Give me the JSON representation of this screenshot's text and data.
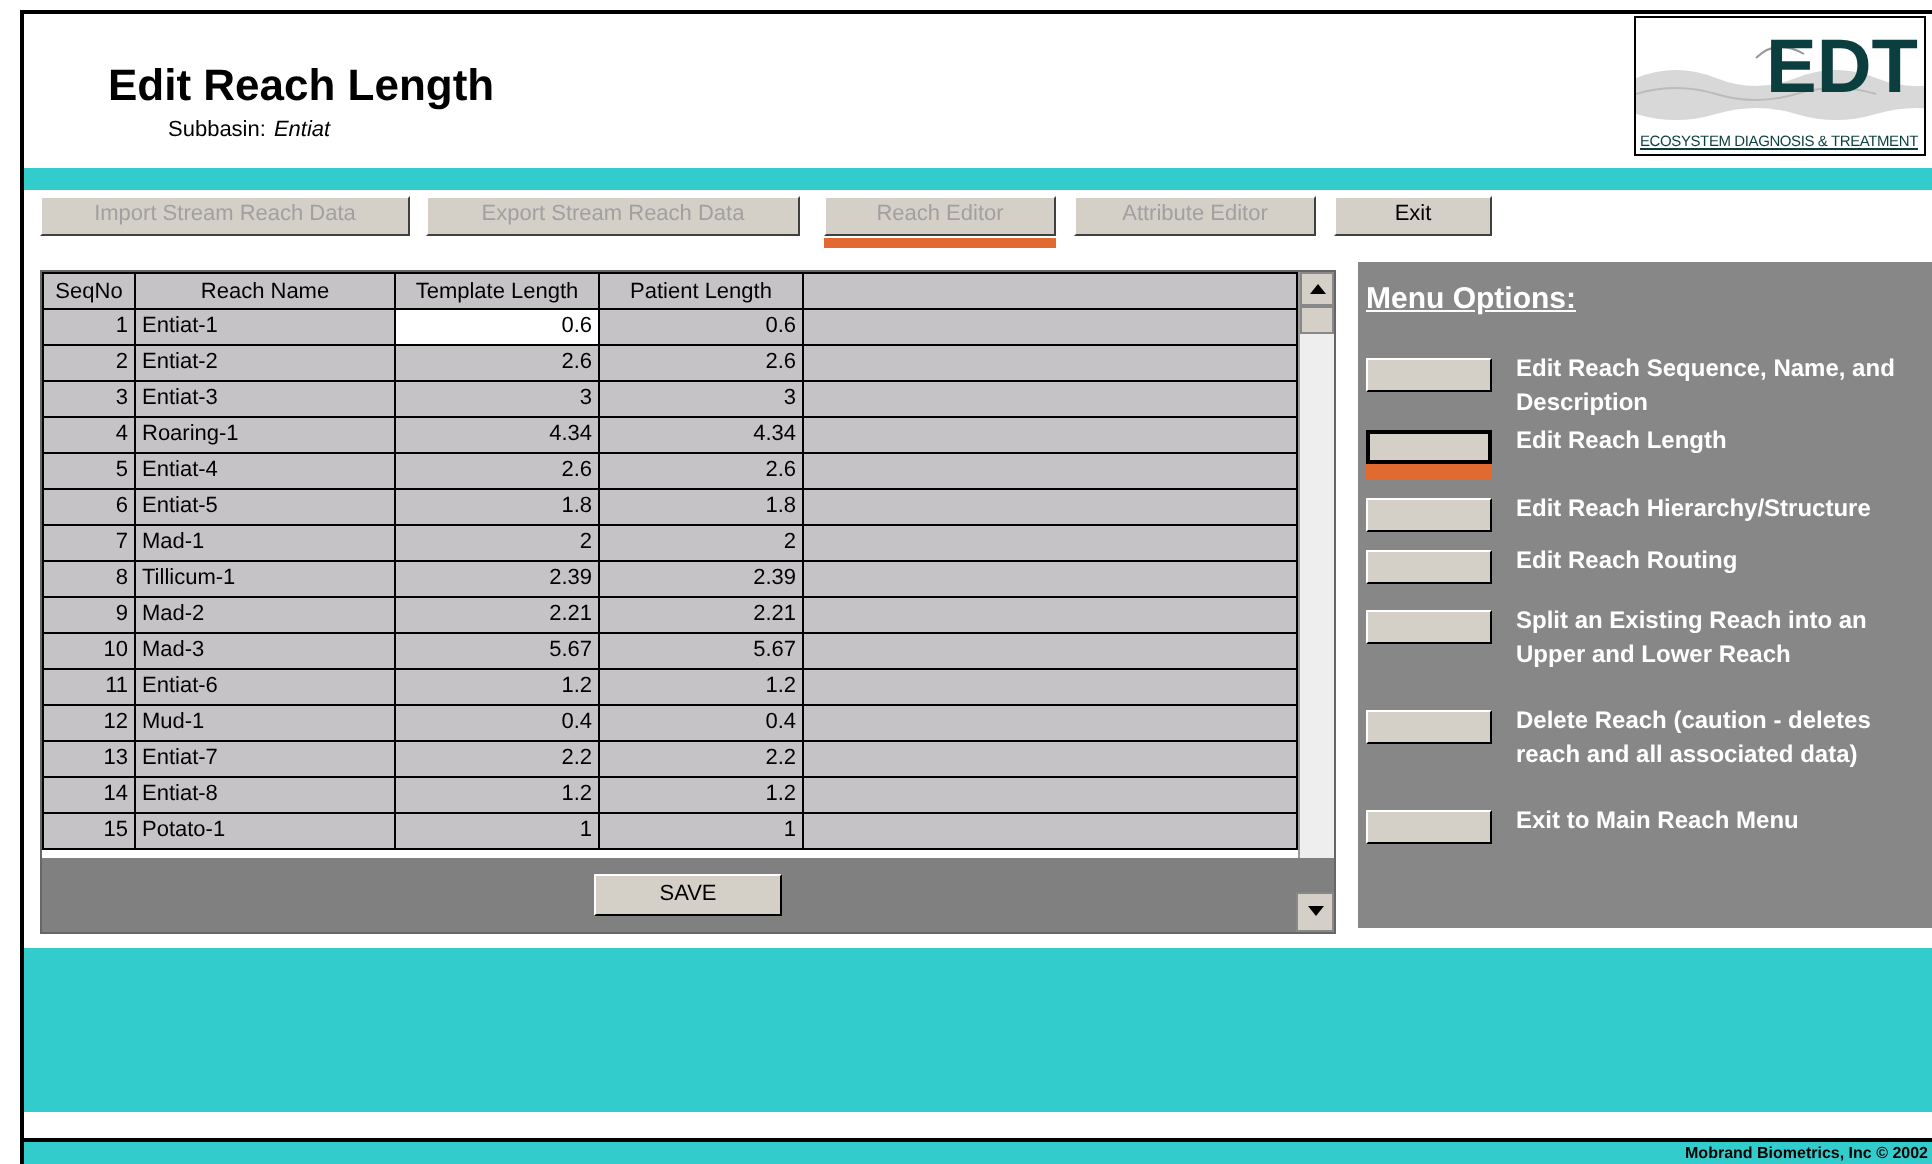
{
  "header": {
    "title": "Edit Reach Length",
    "subtitle_label": "Subbasin:",
    "subtitle_value": "Entiat",
    "logo": {
      "wordmark": "EDT",
      "tagline": "ECOSYSTEM DIAGNOSIS & TREATMENT"
    }
  },
  "tabs": [
    {
      "label": "Import Stream Reach Data",
      "selected": false,
      "disabled": true
    },
    {
      "label": "Export Stream Reach Data",
      "selected": false,
      "disabled": true
    },
    {
      "label": "Reach Editor",
      "selected": true,
      "disabled": true
    },
    {
      "label": "Attribute Editor",
      "selected": false,
      "disabled": true
    },
    {
      "label": "Exit",
      "selected": false,
      "disabled": false
    }
  ],
  "table": {
    "columns": [
      "SeqNo",
      "Reach Name",
      "Template Length",
      "Patient Length"
    ],
    "rows": [
      {
        "cells": [
          "1",
          "Entiat-1",
          "0.6",
          "0.6"
        ],
        "selected": true
      },
      {
        "cells": [
          "2",
          "Entiat-2",
          "2.6",
          "2.6"
        ],
        "selected": false
      },
      {
        "cells": [
          "3",
          "Entiat-3",
          "3",
          "3"
        ],
        "selected": false
      },
      {
        "cells": [
          "4",
          "Roaring-1",
          "4.34",
          "4.34"
        ],
        "selected": false
      },
      {
        "cells": [
          "5",
          "Entiat-4",
          "2.6",
          "2.6"
        ],
        "selected": false
      },
      {
        "cells": [
          "6",
          "Entiat-5",
          "1.8",
          "1.8"
        ],
        "selected": false
      },
      {
        "cells": [
          "7",
          "Mad-1",
          "2",
          "2"
        ],
        "selected": false
      },
      {
        "cells": [
          "8",
          "Tillicum-1",
          "2.39",
          "2.39"
        ],
        "selected": false
      },
      {
        "cells": [
          "9",
          "Mad-2",
          "2.21",
          "2.21"
        ],
        "selected": false
      },
      {
        "cells": [
          "10",
          "Mad-3",
          "5.67",
          "5.67"
        ],
        "selected": false
      },
      {
        "cells": [
          "11",
          "Entiat-6",
          "1.2",
          "1.2"
        ],
        "selected": false
      },
      {
        "cells": [
          "12",
          "Mud-1",
          "0.4",
          "0.4"
        ],
        "selected": false
      },
      {
        "cells": [
          "13",
          "Entiat-7",
          "2.2",
          "2.2"
        ],
        "selected": false
      },
      {
        "cells": [
          "14",
          "Entiat-8",
          "1.2",
          "1.2"
        ],
        "selected": false
      },
      {
        "cells": [
          "15",
          "Potato-1",
          "1",
          "1"
        ],
        "selected": false
      }
    ],
    "save_button": "SAVE"
  },
  "menu": {
    "title": "Menu Options:",
    "items": [
      {
        "label": "Edit Reach Sequence, Name, and Description",
        "selected": false
      },
      {
        "label": "Edit Reach Length",
        "selected": true
      },
      {
        "label": "Edit Reach Hierarchy/Structure",
        "selected": false
      },
      {
        "label": "Edit Reach Routing",
        "selected": false
      },
      {
        "label": "Split an Existing Reach into an Upper and Lower Reach",
        "selected": false
      },
      {
        "label": "Delete Reach (caution - deletes reach and all associated data)",
        "selected": false
      },
      {
        "label": "Exit to Main Reach Menu",
        "selected": false
      }
    ]
  },
  "footer": "Mobrand Biometrics, Inc © 2002"
}
